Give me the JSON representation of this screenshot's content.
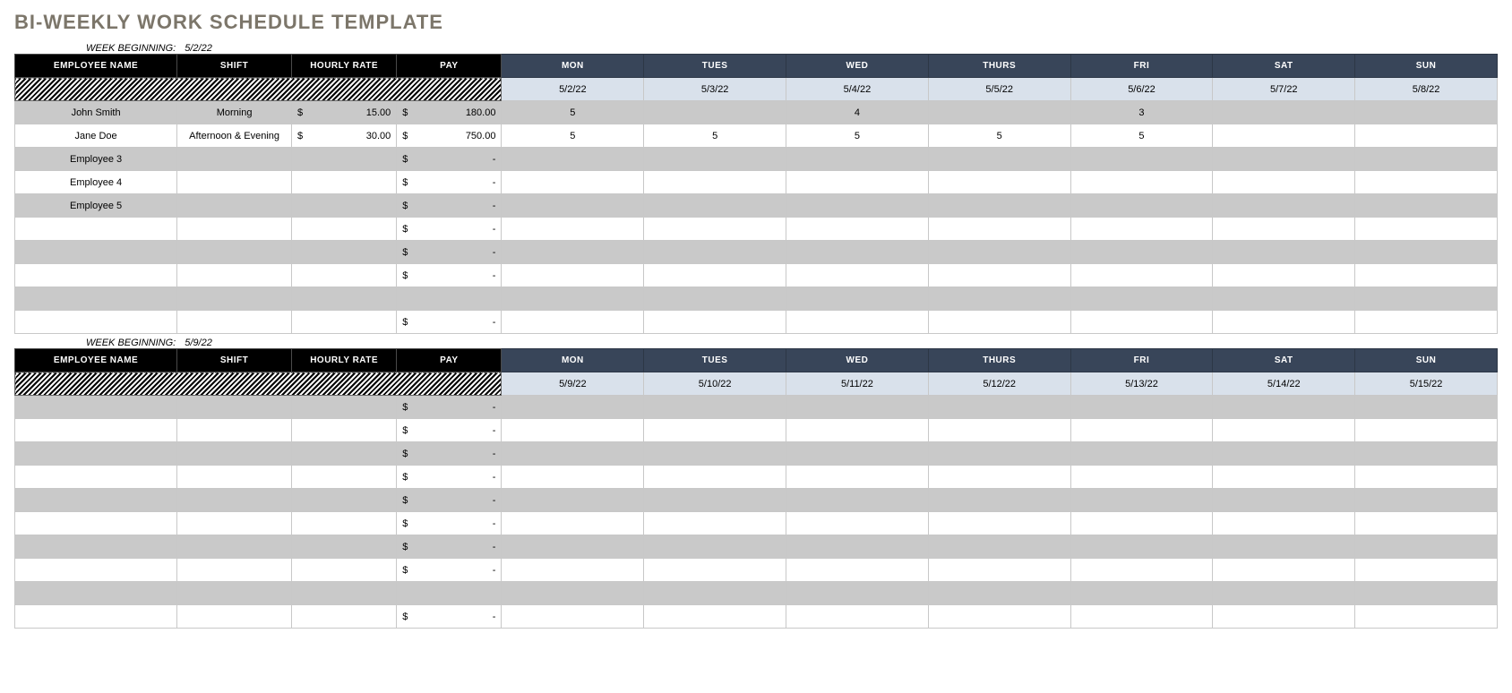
{
  "title": "BI-WEEKLY WORK SCHEDULE TEMPLATE",
  "week_beginning_label": "WEEK BEGINNING:",
  "headers": {
    "employee_name": "EMPLOYEE NAME",
    "shift": "SHIFT",
    "hourly_rate": "HOURLY RATE",
    "pay": "PAY",
    "days": [
      "MON",
      "TUES",
      "WED",
      "THURS",
      "FRI",
      "SAT",
      "SUN"
    ]
  },
  "currency": "$",
  "weeks": [
    {
      "beginning": "5/2/22",
      "dates": [
        "5/2/22",
        "5/3/22",
        "5/4/22",
        "5/5/22",
        "5/6/22",
        "5/7/22",
        "5/8/22"
      ],
      "rows": [
        {
          "name": "John Smith",
          "shift": "Morning",
          "rate": "15.00",
          "pay": "180.00",
          "days": [
            "5",
            "",
            "4",
            "",
            "3",
            "",
            ""
          ]
        },
        {
          "name": "Jane Doe",
          "shift": "Afternoon & Evening",
          "rate": "30.00",
          "pay": "750.00",
          "days": [
            "5",
            "5",
            "5",
            "5",
            "5",
            "",
            ""
          ]
        },
        {
          "name": "Employee 3",
          "shift": "",
          "rate": "",
          "pay": "-",
          "days": [
            "",
            "",
            "",
            "",
            "",
            "",
            ""
          ]
        },
        {
          "name": "Employee 4",
          "shift": "",
          "rate": "",
          "pay": "-",
          "days": [
            "",
            "",
            "",
            "",
            "",
            "",
            ""
          ]
        },
        {
          "name": "Employee 5",
          "shift": "",
          "rate": "",
          "pay": "-",
          "days": [
            "",
            "",
            "",
            "",
            "",
            "",
            ""
          ]
        },
        {
          "name": "",
          "shift": "",
          "rate": "",
          "pay": "-",
          "days": [
            "",
            "",
            "",
            "",
            "",
            "",
            ""
          ]
        },
        {
          "name": "",
          "shift": "",
          "rate": "",
          "pay": "-",
          "days": [
            "",
            "",
            "",
            "",
            "",
            "",
            ""
          ]
        },
        {
          "name": "",
          "shift": "",
          "rate": "",
          "pay": "-",
          "days": [
            "",
            "",
            "",
            "",
            "",
            "",
            ""
          ]
        },
        {
          "name": "",
          "shift": "",
          "rate": "",
          "pay": "",
          "days": [
            "",
            "",
            "",
            "",
            "",
            "",
            ""
          ]
        },
        {
          "name": "",
          "shift": "",
          "rate": "",
          "pay": "-",
          "days": [
            "",
            "",
            "",
            "",
            "",
            "",
            ""
          ]
        }
      ]
    },
    {
      "beginning": "5/9/22",
      "dates": [
        "5/9/22",
        "5/10/22",
        "5/11/22",
        "5/12/22",
        "5/13/22",
        "5/14/22",
        "5/15/22"
      ],
      "rows": [
        {
          "name": "",
          "shift": "",
          "rate": "",
          "pay": "-",
          "days": [
            "",
            "",
            "",
            "",
            "",
            "",
            ""
          ]
        },
        {
          "name": "",
          "shift": "",
          "rate": "",
          "pay": "-",
          "days": [
            "",
            "",
            "",
            "",
            "",
            "",
            ""
          ]
        },
        {
          "name": "",
          "shift": "",
          "rate": "",
          "pay": "-",
          "days": [
            "",
            "",
            "",
            "",
            "",
            "",
            ""
          ]
        },
        {
          "name": "",
          "shift": "",
          "rate": "",
          "pay": "-",
          "days": [
            "",
            "",
            "",
            "",
            "",
            "",
            ""
          ]
        },
        {
          "name": "",
          "shift": "",
          "rate": "",
          "pay": "-",
          "days": [
            "",
            "",
            "",
            "",
            "",
            "",
            ""
          ]
        },
        {
          "name": "",
          "shift": "",
          "rate": "",
          "pay": "-",
          "days": [
            "",
            "",
            "",
            "",
            "",
            "",
            ""
          ]
        },
        {
          "name": "",
          "shift": "",
          "rate": "",
          "pay": "-",
          "days": [
            "",
            "",
            "",
            "",
            "",
            "",
            ""
          ]
        },
        {
          "name": "",
          "shift": "",
          "rate": "",
          "pay": "-",
          "days": [
            "",
            "",
            "",
            "",
            "",
            "",
            ""
          ]
        },
        {
          "name": "",
          "shift": "",
          "rate": "",
          "pay": "",
          "days": [
            "",
            "",
            "",
            "",
            "",
            "",
            ""
          ]
        },
        {
          "name": "",
          "shift": "",
          "rate": "",
          "pay": "-",
          "days": [
            "",
            "",
            "",
            "",
            "",
            "",
            ""
          ]
        }
      ]
    }
  ]
}
